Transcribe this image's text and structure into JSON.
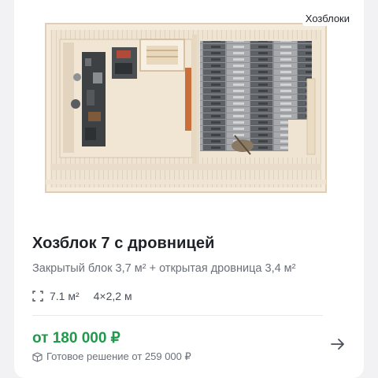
{
  "card": {
    "category": "Хозблоки",
    "title": "Хозблок 7 с дровницей",
    "subtitle": "Закрытый блок 3,7 м² + открытая дровница 3,4 м²",
    "specs": {
      "area": "7.1 м²",
      "dimensions": "4×2,2 м"
    },
    "price": "от 180 000 ₽",
    "ready_solution": "Готовое решение от 259 000 ₽",
    "icons": {
      "area": "area-frame-icon",
      "ready": "box-icon",
      "next": "arrow-right-icon"
    },
    "colors": {
      "price": "#1f9a4a",
      "title": "#1f2328",
      "muted": "#6b7079"
    }
  }
}
